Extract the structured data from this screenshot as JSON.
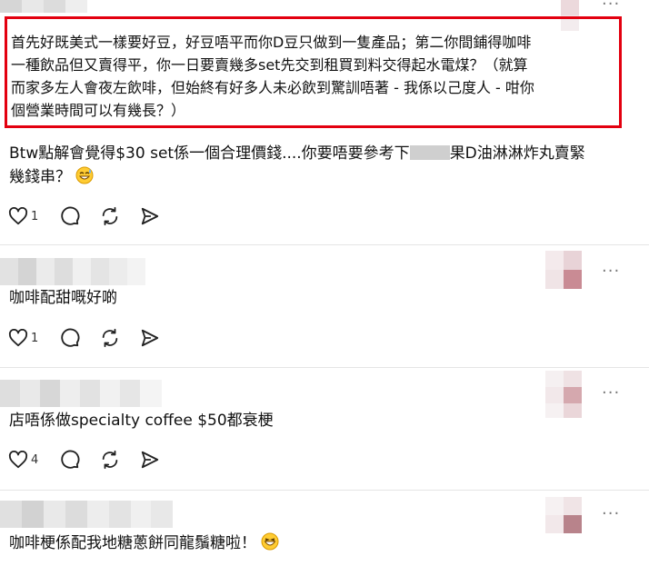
{
  "highlighted_comment": {
    "lines": [
      "首先好既美式一樣要好豆，好豆唔平而你D豆只做到一隻產品；第二你間鋪得咖啡",
      "一種飲品但又賣得平，你一日要賣幾多set先交到租買到料交得起水電煤？（就算",
      "而家多左人會夜左飲啡，但始終有好多人未必飲到驚訓唔著 - 我係以己度人 - 咁你",
      "個營業時間可以有幾長？）"
    ]
  },
  "comment_1": {
    "line1_before": "Btw點解會覺得$30 set係一個合理價錢....你要唔要參考下",
    "line1_after": "果D油淋淋炸丸賣緊",
    "line2": "幾錢串？",
    "like_count": "1"
  },
  "comment_2": {
    "text": "咖啡配甜嘅好啲",
    "like_count": "1"
  },
  "comment_3": {
    "text": "店唔係做specialty coffee $50都衰梗",
    "like_count": "4"
  },
  "comment_4": {
    "text": "咖啡梗係配我地糖蔥餅同龍鬚糖啦！"
  },
  "icons": {
    "like": "heart-icon",
    "reply": "reply-bubble-icon",
    "repost": "repost-icon",
    "share": "share-send-icon",
    "more": "more-dots-icon",
    "emoji": "grinning-sweat-emoji",
    "emoji_laugh": "laughing-emoji"
  },
  "colors": {
    "highlight_border": "#e3000f",
    "icon": "#222222",
    "divider": "#e5e5e5"
  },
  "more_label": "···"
}
